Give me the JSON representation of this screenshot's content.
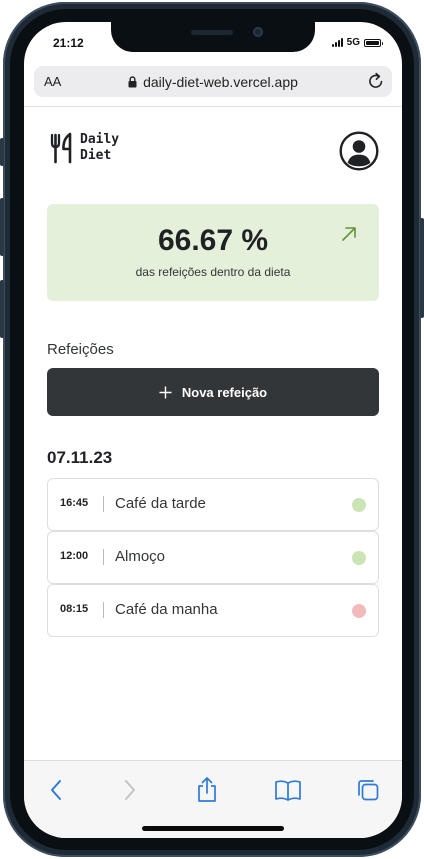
{
  "status_bar": {
    "time": "21:12",
    "network": "5G"
  },
  "browser": {
    "text_size_label": "AA",
    "url": "daily-diet-web.vercel.app"
  },
  "header": {
    "logo_line1": "Daily",
    "logo_line2": "Diet"
  },
  "stats": {
    "percentage": "66.67 %",
    "description": "das refeições dentro da dieta",
    "accent_color": "#639339"
  },
  "meals_section": {
    "title": "Refeições",
    "new_meal_button_label": "Nova refeição"
  },
  "day_groups": [
    {
      "date": "07.11.23",
      "meals": [
        {
          "time": "16:45",
          "name": "Café da tarde",
          "status": "within_diet"
        },
        {
          "time": "12:00",
          "name": "Almoço",
          "status": "within_diet"
        },
        {
          "time": "08:15",
          "name": "Café da manha",
          "status": "off_diet"
        }
      ]
    }
  ],
  "status_colors": {
    "within_diet": "#cbe4b4",
    "off_diet": "#f3babd"
  },
  "toolbar": {
    "items": [
      {
        "icon": "back-chevron-icon",
        "enabled": true
      },
      {
        "icon": "forward-chevron-icon",
        "enabled": false
      },
      {
        "icon": "share-icon",
        "enabled": true
      },
      {
        "icon": "bookmarks-icon",
        "enabled": true
      },
      {
        "icon": "tabs-icon",
        "enabled": true
      }
    ],
    "accent_color": "#2f7ad6"
  }
}
